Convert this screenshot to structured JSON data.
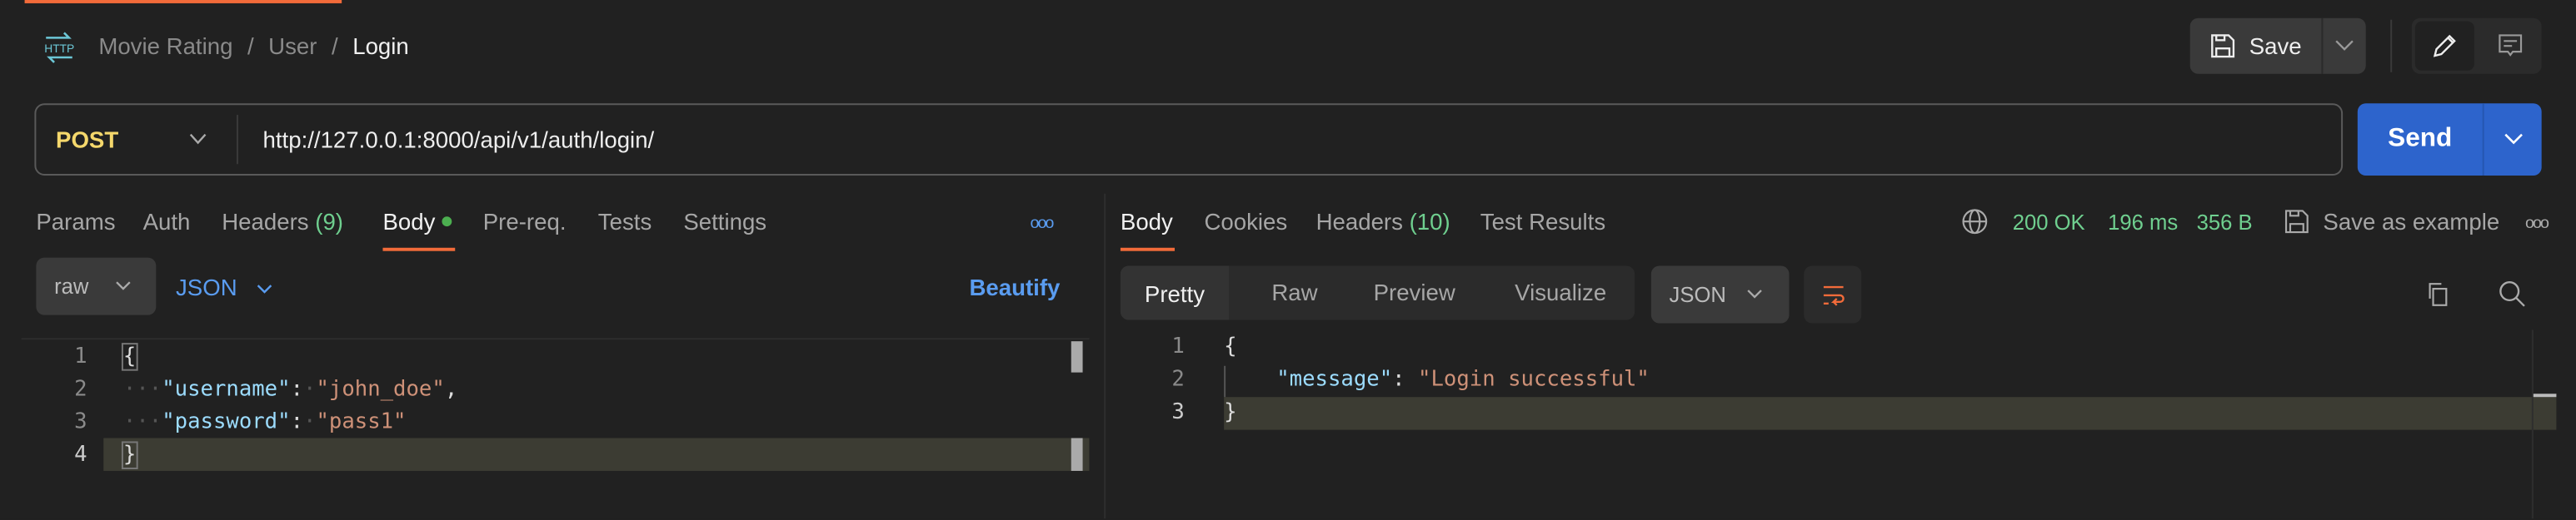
{
  "breadcrumb": {
    "items": [
      "Movie Rating",
      "User"
    ],
    "current": "Login",
    "separator": "/"
  },
  "toolbar": {
    "save_label": "Save"
  },
  "request": {
    "method": "POST",
    "url": "http://127.0.0.1:8000/api/v1/auth/login/",
    "send_label": "Send"
  },
  "request_tabs": [
    {
      "label": "Params"
    },
    {
      "label": "Auth"
    },
    {
      "label": "Headers",
      "count": "(9)"
    },
    {
      "label": "Body",
      "active": true,
      "indicator": "green-dot"
    },
    {
      "label": "Pre-req."
    },
    {
      "label": "Tests"
    },
    {
      "label": "Settings"
    }
  ],
  "body_options": {
    "mode": "raw",
    "language": "JSON",
    "beautify_label": "Beautify"
  },
  "request_body": {
    "line_numbers": [
      "1",
      "2",
      "3",
      "4"
    ],
    "open": "{",
    "close": "}",
    "lines": [
      {
        "key": "\"username\"",
        "value": "\"john_doe\"",
        "comma": ","
      },
      {
        "key": "\"password\"",
        "value": "\"pass1\"",
        "comma": ""
      }
    ]
  },
  "response_tabs": [
    {
      "label": "Body",
      "active": true
    },
    {
      "label": "Cookies"
    },
    {
      "label": "Headers",
      "count": "(10)"
    },
    {
      "label": "Test Results"
    }
  ],
  "response_status": {
    "status": "200 OK",
    "time": "196 ms",
    "size": "356 B",
    "save_example_label": "Save as example"
  },
  "response_views": [
    {
      "label": "Pretty",
      "active": true
    },
    {
      "label": "Raw"
    },
    {
      "label": "Preview"
    },
    {
      "label": "Visualize"
    }
  ],
  "response_format": "JSON",
  "response_body": {
    "line_numbers": [
      "1",
      "2",
      "3"
    ],
    "open": "{",
    "close": "}",
    "key": "\"message\"",
    "value": "\"Login successful\""
  },
  "colors": {
    "accent": "#f26b3a",
    "send": "#2d64cc",
    "method": "#f5d86c",
    "link": "#5a9cf0",
    "status": "#6fcf8f"
  }
}
